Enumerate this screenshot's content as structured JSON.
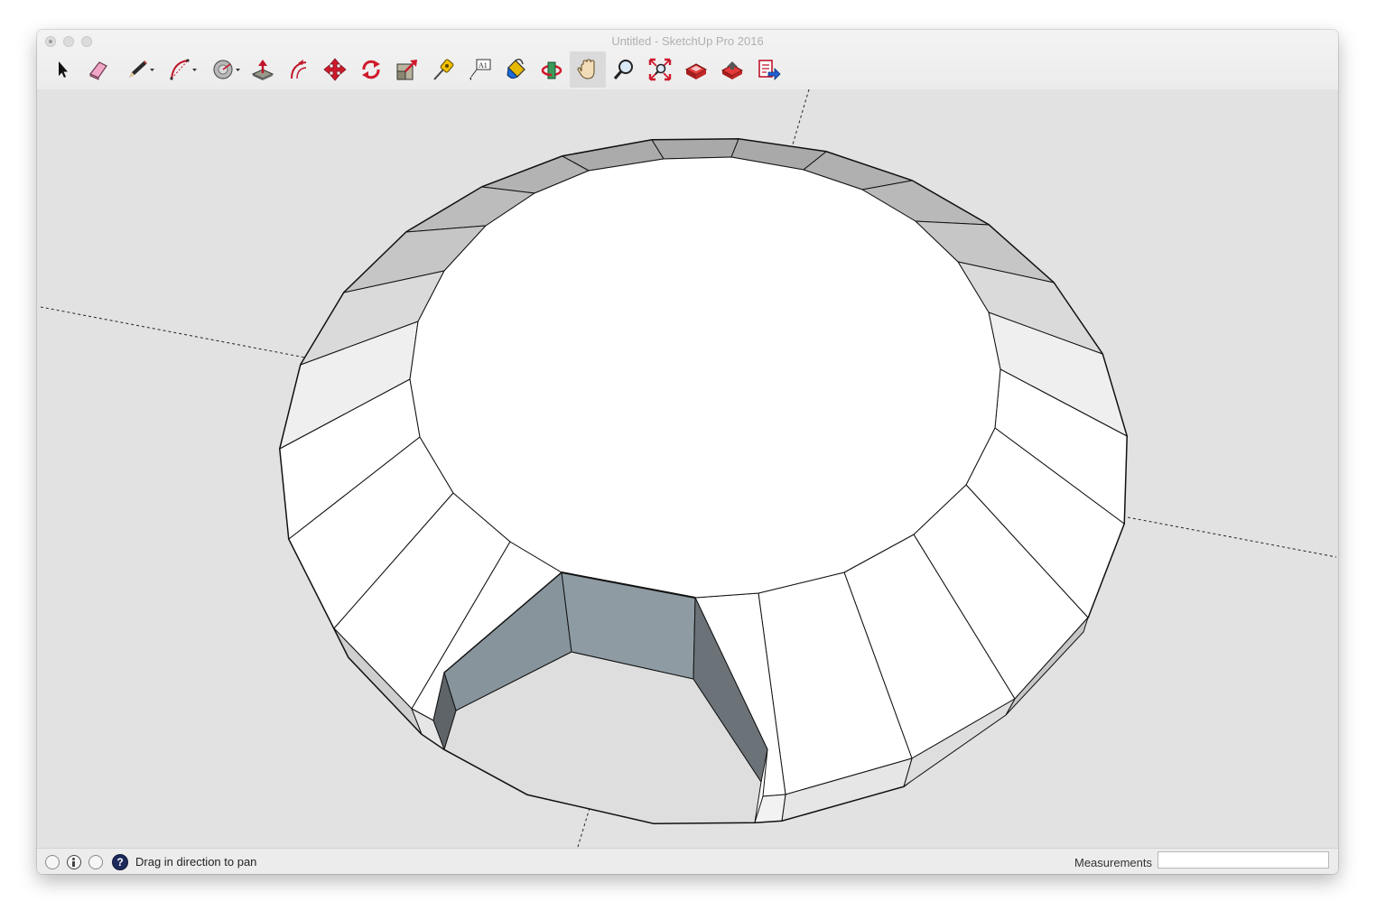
{
  "window": {
    "title": "Untitled - SketchUp Pro 2016"
  },
  "toolbar": {
    "tools": [
      {
        "name": "select-tool",
        "icon": "arrow-cursor-icon"
      },
      {
        "name": "eraser-tool",
        "icon": "eraser-icon"
      },
      {
        "name": "line-tool",
        "icon": "pencil-icon",
        "has_dropdown": true
      },
      {
        "name": "arc-tool",
        "icon": "arc-icon",
        "has_dropdown": true
      },
      {
        "name": "shapes-tool",
        "icon": "shapes-icon",
        "has_dropdown": true
      },
      {
        "name": "push-pull-tool",
        "icon": "push-pull-icon"
      },
      {
        "name": "offset-tool",
        "icon": "offset-icon"
      },
      {
        "name": "move-tool",
        "icon": "move-arrows-icon"
      },
      {
        "name": "rotate-tool",
        "icon": "rotate-icon"
      },
      {
        "name": "scale-tool",
        "icon": "scale-icon"
      },
      {
        "name": "tape-measure-tool",
        "icon": "tape-measure-icon"
      },
      {
        "name": "text-tool",
        "icon": "text-label-icon",
        "label": "A1"
      },
      {
        "name": "paint-bucket-tool",
        "icon": "paint-bucket-icon"
      },
      {
        "name": "orbit-tool",
        "icon": "orbit-icon"
      },
      {
        "name": "pan-tool",
        "icon": "hand-pan-icon",
        "active": true
      },
      {
        "name": "zoom-tool",
        "icon": "magnifier-icon"
      },
      {
        "name": "zoom-extents-tool",
        "icon": "zoom-extents-icon"
      },
      {
        "name": "warehouse-tool",
        "icon": "3d-warehouse-icon"
      },
      {
        "name": "extension-warehouse-tool",
        "icon": "extension-warehouse-icon"
      },
      {
        "name": "send-to-layout-tool",
        "icon": "send-to-layout-icon"
      }
    ]
  },
  "statusbar": {
    "message": "Drag in direction to pan",
    "help_glyph": "?",
    "measurements_label": "Measurements",
    "measurements_value": ""
  },
  "colors": {
    "canvas_bg": "#e2e2e2",
    "face_white": "#ffffff",
    "face_light_gray": "#c8c8c8",
    "face_back": "#8e9aa2",
    "face_dark": "#6c7378"
  }
}
